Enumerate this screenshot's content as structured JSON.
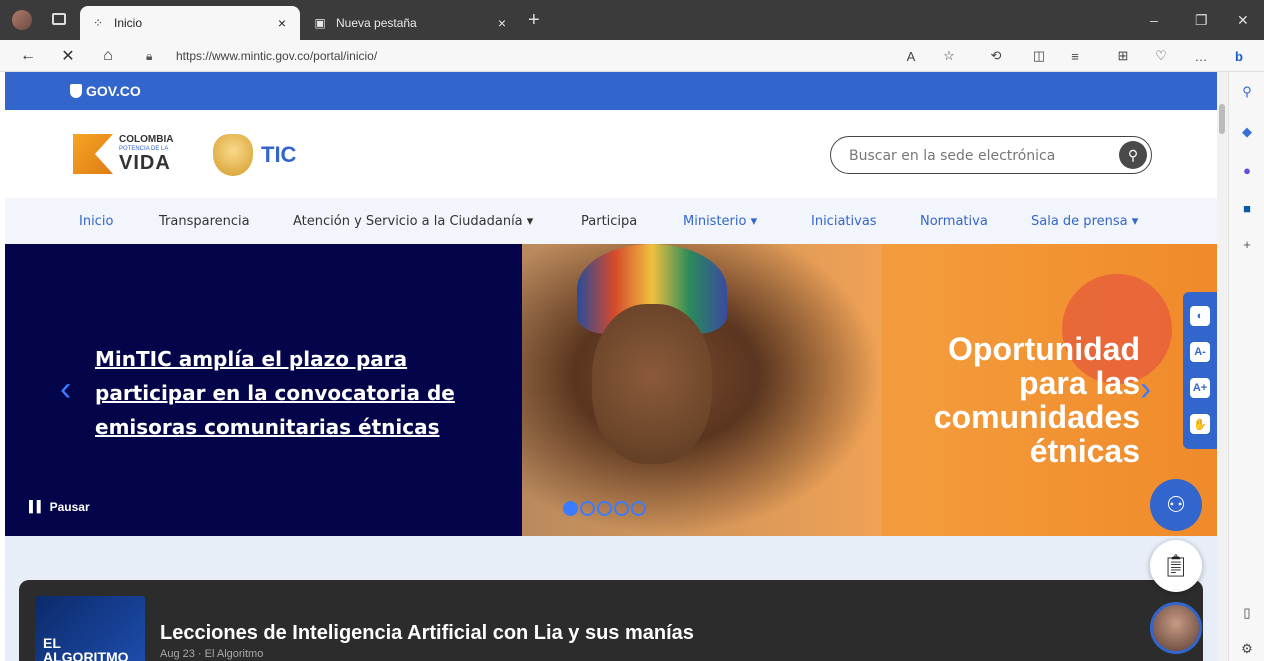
{
  "browser": {
    "tabs": [
      {
        "title": "Inicio",
        "active": true
      },
      {
        "title": "Nueva pestaña",
        "active": false
      }
    ],
    "url": "https://www.mintic.gov.co/portal/inicio/"
  },
  "govbar": {
    "label": "GOV.CO"
  },
  "brands": {
    "colombia_line1": "COLOMBIA",
    "colombia_line2": "POTENCIA DE LA",
    "colombia_line3": "VIDA",
    "tic": "TIC"
  },
  "search": {
    "placeholder": "Buscar en la sede electrónica"
  },
  "nav": {
    "items": [
      {
        "label": "Inicio"
      },
      {
        "label": "Transparencia"
      },
      {
        "label": "Atención y Servicio a la Ciudadanía ▾"
      },
      {
        "label": "Participa"
      },
      {
        "label": "Ministerio ▾"
      },
      {
        "label": "Iniciativas"
      },
      {
        "label": "Normativa"
      },
      {
        "label": "Sala de prensa ▾"
      }
    ]
  },
  "hero": {
    "headline": "MinTIC amplía el plazo para participar en la convocatoria de emisoras comunitarias étnicas",
    "pause_label": "Pausar",
    "banner_text": "Oportunidad para las comunidades étnicas",
    "slides": 5,
    "active_slide": 1
  },
  "accessibility": {
    "contrast": "◐",
    "font_decrease": "A-",
    "font_increase": "A+",
    "sign_language": "✋"
  },
  "podcast": {
    "cover_text": "EL ALGORITMO",
    "title": "Lecciones de Inteligencia Artificial con Lia y sus manías",
    "meta": "Aug 23 · El Algoritmo"
  },
  "colors": {
    "gov_blue": "#3366cc",
    "hero_dark": "#04044a",
    "hero_orange": "#f39a3a"
  }
}
